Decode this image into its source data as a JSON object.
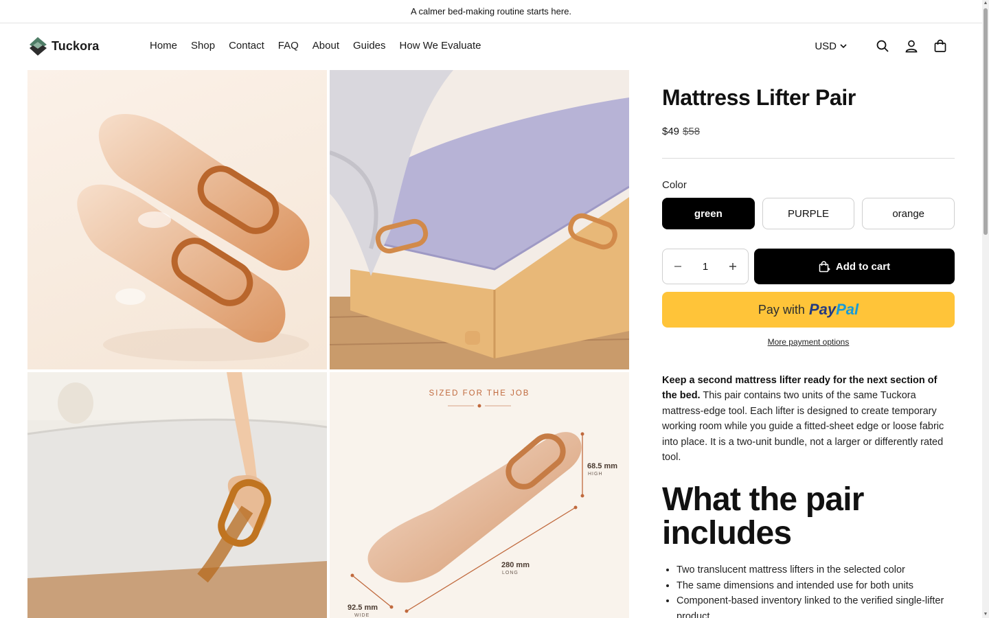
{
  "announcement": "A calmer bed-making routine starts here.",
  "brand": {
    "name": "Tuckora",
    "logo_icon": "diamond-leaf-icon"
  },
  "nav": [
    "Home",
    "Shop",
    "Contact",
    "FAQ",
    "About",
    "Guides",
    "How We Evaluate"
  ],
  "header_actions": {
    "currency": "USD",
    "icons": [
      "search-icon",
      "account-icon",
      "cart-icon"
    ]
  },
  "gallery": {
    "infographic_heading": "SIZED FOR THE JOB",
    "dimensions": [
      {
        "value": "68.5 mm",
        "label": "HIGH"
      },
      {
        "value": "280 mm",
        "label": "LONG"
      },
      {
        "value": "92.5 mm",
        "label": "WIDE"
      }
    ]
  },
  "product": {
    "title": "Mattress Lifter Pair",
    "price": "$49",
    "compare_price": "$58",
    "color_label": "Color",
    "colors": [
      "green",
      "PURPLE",
      "orange"
    ],
    "selected_color": "green",
    "quantity": "1",
    "add_to_cart": "Add to cart",
    "paypal_prefix": "Pay with",
    "paypal_brand_a": "Pay",
    "paypal_brand_b": "Pal",
    "more_payment": "More payment options",
    "description_bold": "Keep a second mattress lifter ready for the next section of the bed.",
    "description_rest": " This pair contains two units of the same Tuckora mattress-edge tool. Each lifter is designed to create temporary working room while you guide a fitted-sheet edge or loose fabric into place. It is a two-unit bundle, not a larger or differently rated tool.",
    "includes_heading": "What the pair includes",
    "includes": [
      "Two translucent mattress lifters in the selected color",
      "The same dimensions and intended use for both units",
      "Component-based inventory linked to the verified single-lifter product"
    ]
  }
}
